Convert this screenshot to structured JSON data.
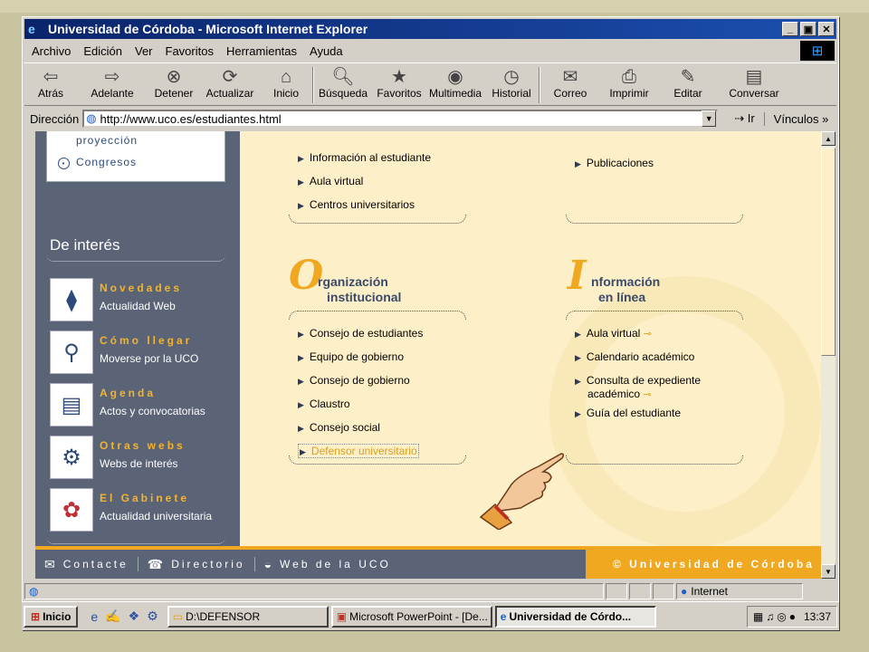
{
  "window": {
    "title": "Universidad de Córdoba - Microsoft Internet Explorer",
    "minimize": "_",
    "maximize": "▣",
    "close": "✕"
  },
  "menu": [
    "Archivo",
    "Edición",
    "Ver",
    "Favoritos",
    "Herramientas",
    "Ayuda"
  ],
  "toolbar": [
    {
      "label": "Atrás",
      "icon": "back-arrow-icon"
    },
    {
      "label": "Adelante",
      "icon": "forward-arrow-icon"
    },
    {
      "label": "Detener",
      "icon": "stop-icon"
    },
    {
      "label": "Actualizar",
      "icon": "refresh-icon"
    },
    {
      "label": "Inicio",
      "icon": "home-icon"
    },
    {
      "label": "Búsqueda",
      "icon": "search-icon"
    },
    {
      "label": "Favoritos",
      "icon": "favorites-icon"
    },
    {
      "label": "Multimedia",
      "icon": "multimedia-icon"
    },
    {
      "label": "Historial",
      "icon": "history-icon"
    },
    {
      "label": "Correo",
      "icon": "mail-icon"
    },
    {
      "label": "Imprimir",
      "icon": "print-icon"
    },
    {
      "label": "Editar",
      "icon": "edit-icon"
    },
    {
      "label": "Conversar",
      "icon": "discuss-icon"
    }
  ],
  "address": {
    "label": "Dirección",
    "url": "http://www.uco.es/estudiantes.html",
    "go": "Ir",
    "links": "Vínculos"
  },
  "sidebar": {
    "box_items": [
      "proyección",
      "Congresos"
    ],
    "section_title": "De interés",
    "items": [
      {
        "title": "Novedades",
        "subtitle": "Actualidad Web",
        "icon": "needle-icon"
      },
      {
        "title": "Cómo llegar",
        "subtitle": "Moverse por la UCO",
        "icon": "bicycle-icon"
      },
      {
        "title": "Agenda",
        "subtitle": "Actos y convocatorias",
        "icon": "book-icon"
      },
      {
        "title": "Otras webs",
        "subtitle": "Webs de interés",
        "icon": "magnifier-icon"
      },
      {
        "title": "El Gabinete",
        "subtitle": "Actualidad universitaria",
        "icon": "seal-icon"
      }
    ]
  },
  "main": {
    "top_left_links": [
      "Información al estudiante",
      "Aula virtual",
      "Centros universitarios"
    ],
    "top_right_links": [
      "Publicaciones"
    ],
    "org": {
      "initial": "O",
      "line1": "rganización",
      "line2": "institucional",
      "links": [
        "Consejo de estudiantes",
        "Equipo de gobierno",
        "Consejo de gobierno",
        "Claustro",
        "Consejo social",
        "Defensor universitario"
      ]
    },
    "info": {
      "initial": "I",
      "line1": "nformación",
      "line2": "en línea",
      "links": [
        "Aula virtual",
        "Calendario académico",
        "Consulta de expediente",
        "académico",
        "Guía del estudiante"
      ]
    }
  },
  "footer": {
    "contact": "Contacte",
    "directory": "Directorio",
    "web": "Web de la UCO",
    "copyright": "© Universidad de Córdoba"
  },
  "status": {
    "zone": "Internet"
  },
  "taskbar": {
    "start": "Inicio",
    "tasks": [
      "D:\\DEFENSOR",
      "Microsoft PowerPoint - [De...",
      "Universidad de Córdo..."
    ],
    "clock": "13:37"
  }
}
